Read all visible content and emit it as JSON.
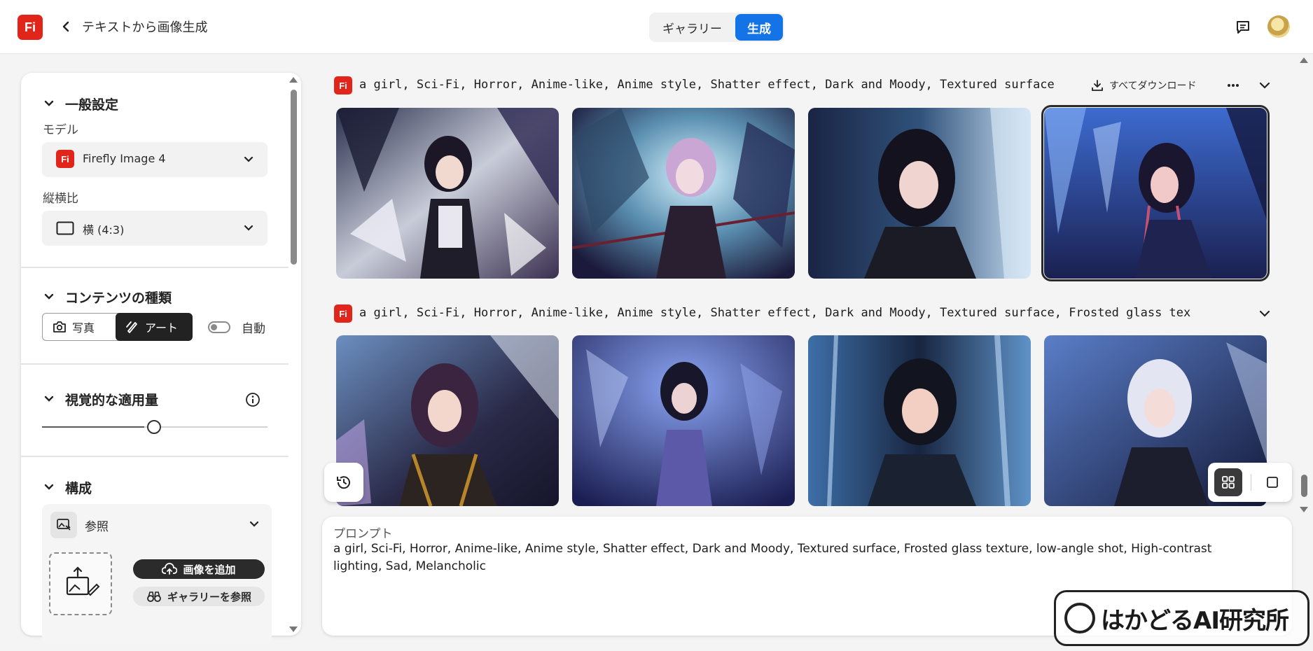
{
  "header": {
    "logo_text": "Fi",
    "title": "テキストから画像生成",
    "tabs": [
      {
        "label": "ギャラリー",
        "active": false
      },
      {
        "label": "生成",
        "active": true
      }
    ]
  },
  "sidebar": {
    "general": {
      "title": "一般設定",
      "model_label": "モデル",
      "model_value": "Firefly Image 4",
      "aspect_label": "縦横比",
      "aspect_value": "横 (4:3)"
    },
    "content_type": {
      "title": "コンテンツの種類",
      "photo": "写真",
      "art": "アート",
      "auto": "自動",
      "selected": "art",
      "auto_on": false
    },
    "visual_intensity": {
      "title": "視覚的な適用量",
      "level_fraction": 0.46
    },
    "composition": {
      "title": "構成",
      "reference_label": "参照",
      "add_image": "画像を追加",
      "browse_gallery": "ギャラリーを参照"
    }
  },
  "results": [
    {
      "prompt": "a girl, Sci-Fi, Horror, Anime-like, Anime style, Shatter effect, Dark and Moody, Textured surface",
      "download_all": "すべてダウンロード",
      "images": [
        {
          "desc": "shattered anime girl 1",
          "selected": false
        },
        {
          "desc": "shattered anime girl 2",
          "selected": false
        },
        {
          "desc": "shattered anime girl 3",
          "selected": false
        },
        {
          "desc": "shattered anime girl 4",
          "selected": true
        }
      ]
    },
    {
      "prompt": "a girl, Sci-Fi, Horror, Anime-like, Anime style, Shatter effect, Dark and Moody, Textured surface, Frosted glass tex",
      "images": [
        {
          "desc": "frosted glass anime girl 1",
          "selected": false
        },
        {
          "desc": "frosted glass anime girl 2",
          "selected": false
        },
        {
          "desc": "frosted glass anime girl 3",
          "selected": false
        },
        {
          "desc": "frosted glass anime girl 4",
          "selected": false
        }
      ]
    }
  ],
  "prompt_box": {
    "label": "プロンプト",
    "text": "a girl, Sci-Fi, Horror, Anime-like, Anime style, Shatter effect, Dark and Moody, Textured surface, Frosted glass texture, low-angle shot, High-contrast lighting, Sad, Melancholic"
  },
  "watermark": {
    "text": "はかどるAI研究所"
  },
  "colors": {
    "brand_red": "#e1251b",
    "accent_blue": "#1473e6"
  }
}
